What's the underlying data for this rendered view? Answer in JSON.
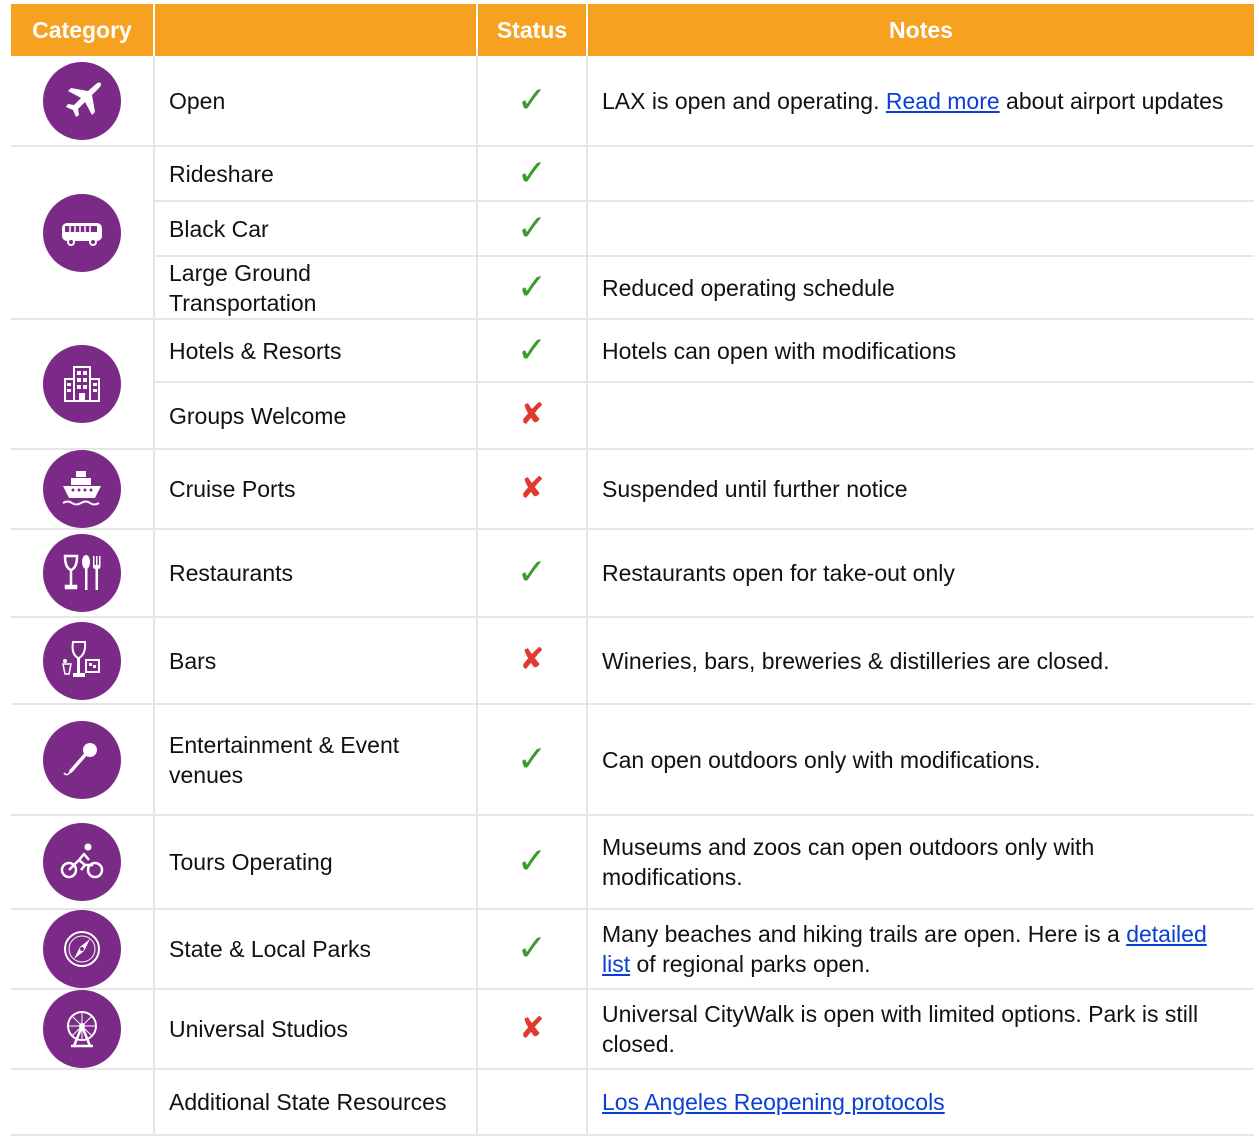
{
  "header": {
    "category": "Category",
    "status": "Status",
    "notes": "Notes"
  },
  "colors": {
    "header_bg": "#f7a121",
    "icon_bg": "#7b2a87",
    "check": "#3c9a2e",
    "cross": "#e03a2f",
    "link": "#0a3fd6"
  },
  "rows": {
    "r0": {
      "name": "Open",
      "status": "check",
      "icon": "airplane-icon",
      "notes_pre": "LAX is open and operating. ",
      "notes_link": "Read more",
      "notes_post": " about airport updates"
    },
    "r1": {
      "name": "Rideshare",
      "status": "check",
      "icon": "bus-icon"
    },
    "r2": {
      "name": "Black Car",
      "status": "check"
    },
    "r3": {
      "name": "Large Ground Transportation",
      "status": "check",
      "notes": "Reduced operating schedule"
    },
    "r4": {
      "name": "Hotels & Resorts",
      "status": "check",
      "icon": "hotel-icon",
      "notes": "Hotels can open with modifications"
    },
    "r5": {
      "name": "Groups Welcome",
      "status": "cross"
    },
    "r6": {
      "name": "Cruise Ports",
      "status": "cross",
      "icon": "ship-icon",
      "notes": "Suspended until further notice"
    },
    "r7": {
      "name": "Restaurants",
      "status": "check",
      "icon": "dining-icon",
      "notes": "Restaurants open for take-out only"
    },
    "r8": {
      "name": "Bars",
      "status": "cross",
      "icon": "drinks-icon",
      "notes": "Wineries, bars, breweries & distilleries are closed."
    },
    "r9": {
      "name": "Entertainment & Event venues",
      "status": "check",
      "icon": "microphone-icon",
      "notes": "Can open outdoors only with modifications."
    },
    "r10": {
      "name": "Tours Operating",
      "status": "check",
      "icon": "cyclist-icon",
      "notes": "Museums and zoos can open outdoors only with modifications."
    },
    "r11": {
      "name": "State & Local Parks",
      "status": "check",
      "icon": "compass-icon",
      "notes_pre": "Many beaches and hiking trails are open. Here is a ",
      "notes_link": "detailed list",
      "notes_post": " of regional parks open."
    },
    "r12": {
      "name": "Universal Studios",
      "status": "cross",
      "icon": "ferris-wheel-icon",
      "notes": "Universal CityWalk is open with limited options.  Park is still closed."
    },
    "r13": {
      "name": "Additional State Resources",
      "notes_link": "Los Angeles Reopening protocols"
    }
  },
  "status_glyphs": {
    "check": "✓",
    "cross": "✘"
  }
}
